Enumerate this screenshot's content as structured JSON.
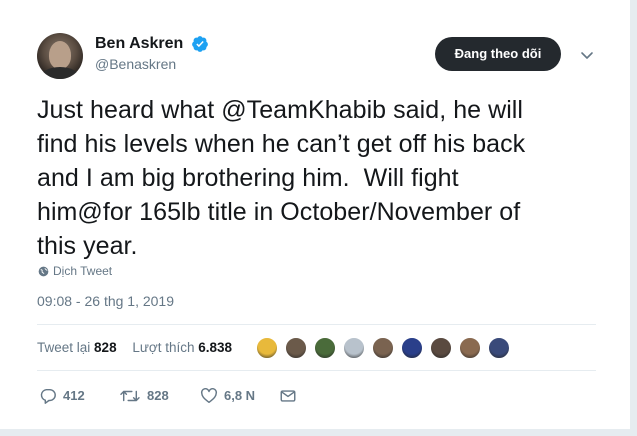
{
  "author": {
    "display_name": "Ben Askren",
    "handle": "@Benaskren",
    "verified_icon": "verified-badge-icon"
  },
  "follow_button_label": "Đang theo dõi",
  "tweet": {
    "text": "Just heard what @TeamKhabib said, he will\nfind his levels when he can’t get off his back\nand I am big brothering him.  Will fight\nhim@for 165lb title in October/November of\nthis year.",
    "translate_label": "Dịch Tweet",
    "timestamp": "09:08 - 26 thg 1, 2019"
  },
  "stats": {
    "retweets_label": "Tweet lại",
    "retweets_count": "828",
    "likes_label": "Lượt thích",
    "likes_count": "6.838"
  },
  "liker_avatars": [
    "#e8b93b",
    "#6b5a4a",
    "#4a6b3a",
    "#b8c2cc",
    "#7a6350",
    "#2a3f8a",
    "#5a4a40",
    "#8a6a50",
    "#3a4a7a"
  ],
  "actions": {
    "reply_count": "412",
    "retweet_count": "828",
    "like_count": "6,8 N"
  },
  "colors": {
    "text": "#14171a",
    "secondary": "#657786",
    "verified": "#1da1f2",
    "follow_bg": "#24292e"
  }
}
